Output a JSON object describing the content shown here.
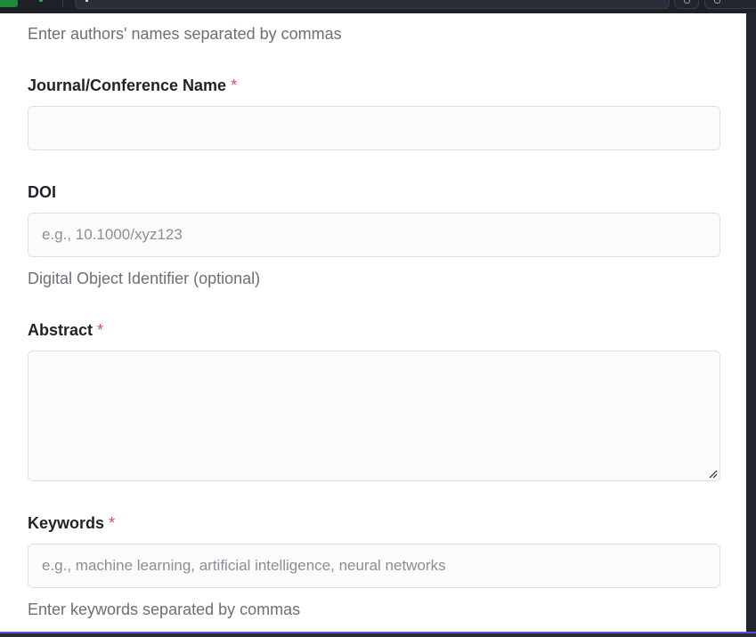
{
  "form": {
    "authors_help": "Enter authors' names separated by commas",
    "journal": {
      "label": "Journal/Conference Name",
      "required_mark": "*",
      "value": ""
    },
    "doi": {
      "label": "DOI",
      "placeholder": "e.g., 10.1000/xyz123",
      "value": "",
      "help": "Digital Object Identifier (optional)"
    },
    "abstract": {
      "label": "Abstract",
      "required_mark": "*",
      "value": ""
    },
    "keywords": {
      "label": "Keywords",
      "required_mark": "*",
      "placeholder": "e.g., machine learning, artificial intelligence, neural networks",
      "value": "",
      "help": "Enter keywords separated by commas"
    }
  },
  "colors": {
    "required": "#e5484d",
    "help_text": "#6b6f76",
    "field_border": "#dcdfe4",
    "accent_bar": "#5b4fd6"
  }
}
